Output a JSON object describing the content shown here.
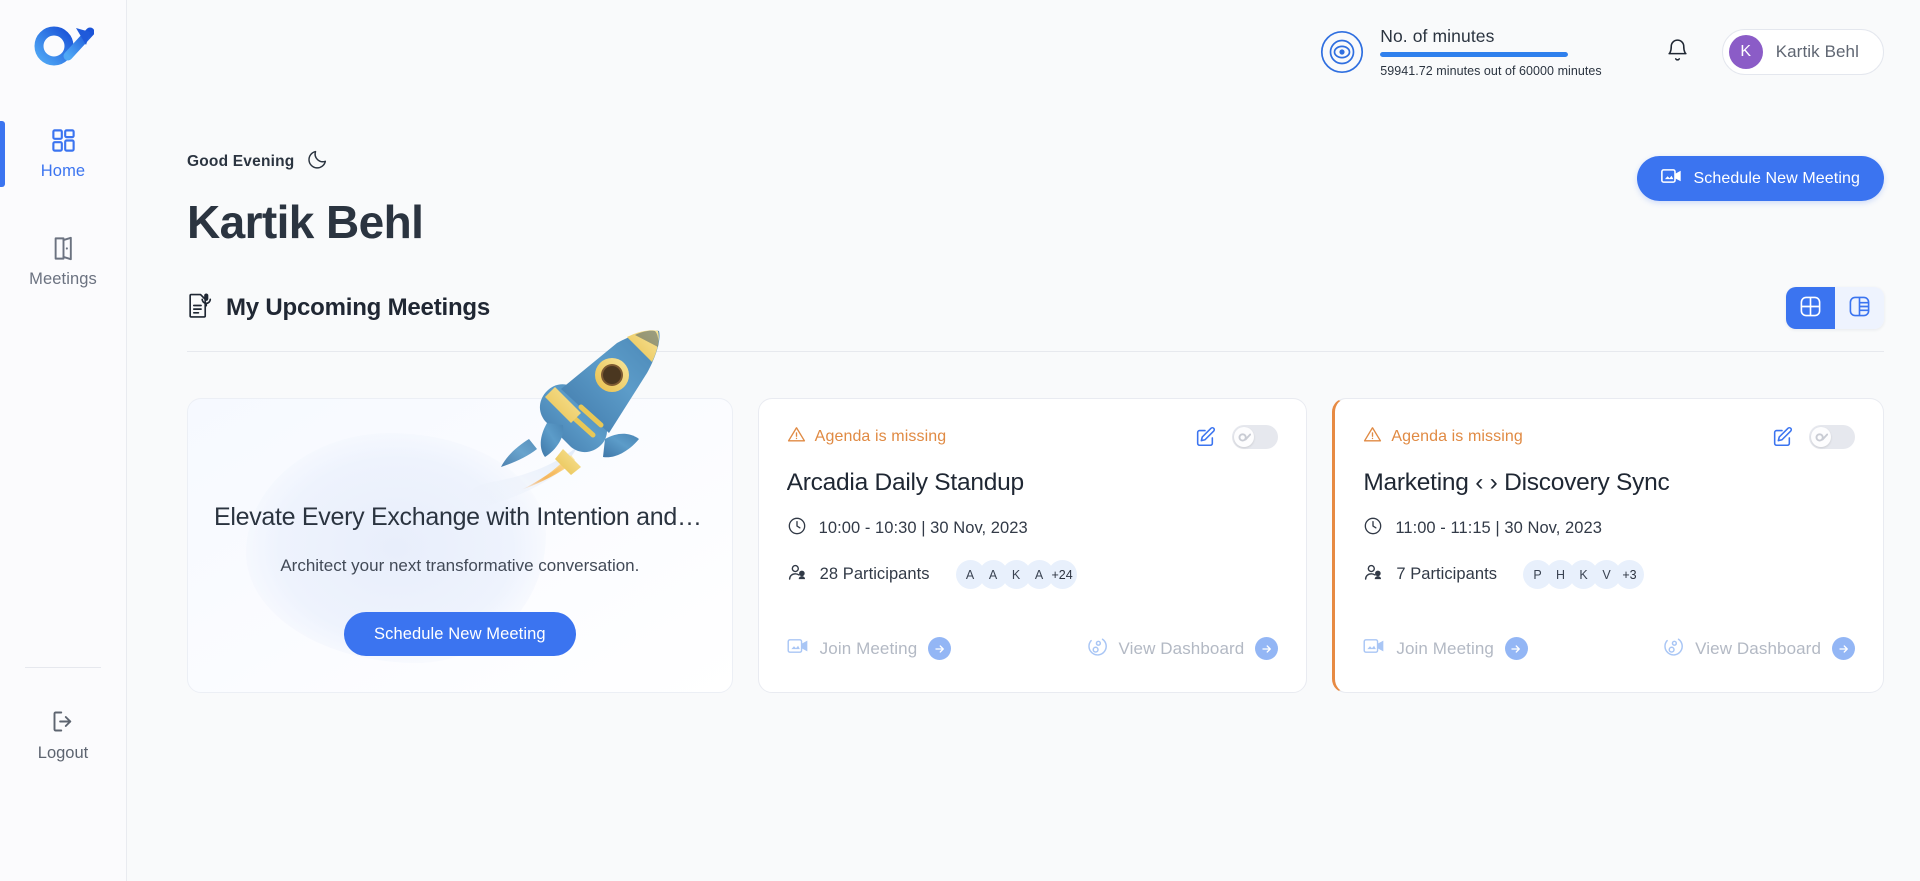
{
  "brand": {
    "logo_name": "ox-logo",
    "accent": "#3b74f0",
    "warning": "#e08a43",
    "avatar_bg": "#8b5cc7"
  },
  "sidebar": {
    "items": [
      {
        "id": "home",
        "label": "Home",
        "icon": "grid-icon",
        "active": true
      },
      {
        "id": "meetings",
        "label": "Meetings",
        "icon": "door-icon",
        "active": false
      }
    ],
    "logout": {
      "label": "Logout",
      "icon": "logout-icon"
    }
  },
  "topbar": {
    "minutes": {
      "icon": "target-icon",
      "title": "No. of minutes",
      "subtitle": "59941.72 minutes out of 60000 minutes",
      "used": 59941.72,
      "total": 60000,
      "percent": 99.9
    },
    "notifications_icon": "bell-icon",
    "user": {
      "initial": "K",
      "name": "Kartik Behl"
    }
  },
  "greeting": {
    "text": "Good Evening",
    "icon": "moon-icon",
    "name": "Kartik Behl",
    "schedule_button": {
      "label": "Schedule New Meeting",
      "icon": "video-icon"
    }
  },
  "section": {
    "icon": "agenda-doc-icon",
    "title": "My Upcoming Meetings",
    "views": [
      {
        "id": "grid",
        "icon": "grid-view-icon",
        "active": true
      },
      {
        "id": "list",
        "icon": "list-view-icon",
        "active": false
      }
    ]
  },
  "promo_card": {
    "title": "Elevate Every Exchange with Intention and I...",
    "subtitle": "Architect your next transformative conversation.",
    "button_label": "Schedule New Meeting",
    "illustration": "rocket-illustration"
  },
  "meetings": [
    {
      "warning": "Agenda is missing",
      "warning_icon": "warning-triangle-icon",
      "edit_icon": "edit-square-icon",
      "toggle_on": false,
      "flagged": false,
      "title": "Arcadia Daily Standup",
      "time_icon": "clock-icon",
      "time": "10:00 - 10:30 | 30 Nov, 2023",
      "participants_icon": "people-icon",
      "participants_label": "28 Participants",
      "participant_count": 28,
      "avatars": [
        "A",
        "A",
        "K",
        "A"
      ],
      "avatars_more": "+24",
      "actions": [
        {
          "id": "join",
          "label": "Join Meeting",
          "icon": "video-icon",
          "arrow": "arrow-right-icon"
        },
        {
          "id": "dashboard",
          "label": "View Dashboard",
          "icon": "dashboard-icon",
          "arrow": "arrow-right-icon"
        }
      ]
    },
    {
      "warning": "Agenda is missing",
      "warning_icon": "warning-triangle-icon",
      "edit_icon": "edit-square-icon",
      "toggle_on": false,
      "flagged": true,
      "title": "Marketing ‹ › Discovery Sync",
      "time_icon": "clock-icon",
      "time": "11:00 - 11:15 | 30 Nov, 2023",
      "participants_icon": "people-icon",
      "participants_label": "7 Participants",
      "participant_count": 7,
      "avatars": [
        "P",
        "H",
        "K",
        "V"
      ],
      "avatars_more": "+3",
      "actions": [
        {
          "id": "join",
          "label": "Join Meeting",
          "icon": "video-icon",
          "arrow": "arrow-right-icon"
        },
        {
          "id": "dashboard",
          "label": "View Dashboard",
          "icon": "dashboard-icon",
          "arrow": "arrow-right-icon"
        }
      ]
    }
  ]
}
